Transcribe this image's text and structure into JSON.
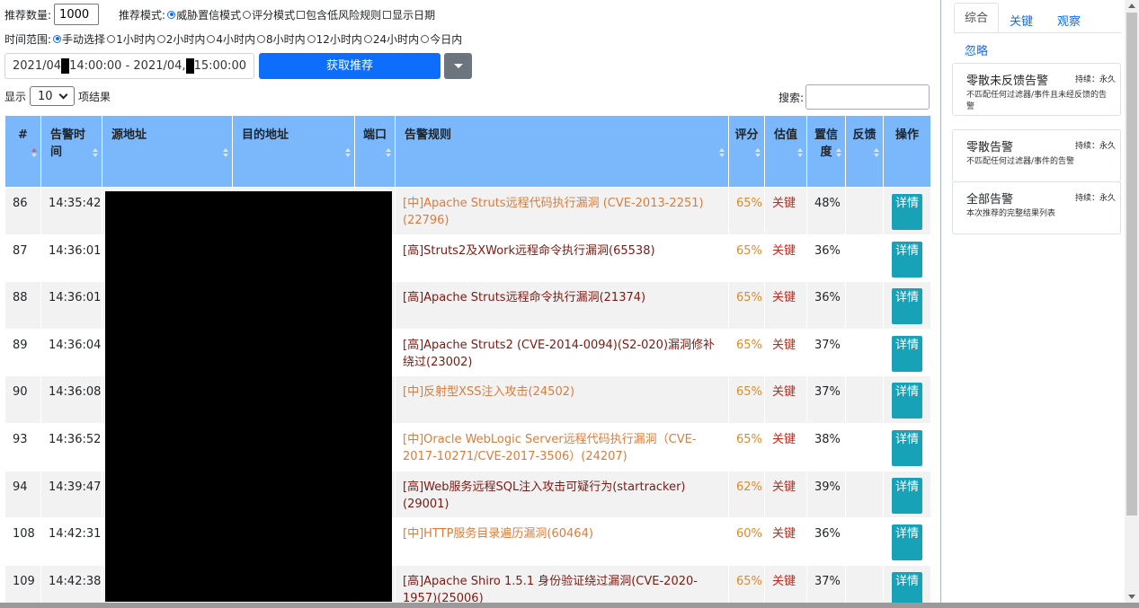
{
  "controls": {
    "count_label": "推荐数量:",
    "count_value": "1000",
    "mode_label": "推荐模式:",
    "mode_options": [
      "威胁置信模式",
      "评分模式"
    ],
    "checkbox_options": [
      "包含低风险规则",
      "显示日期"
    ],
    "time_label": "时间范围:",
    "time_options": [
      "手动选择",
      "1小时内",
      "2小时内",
      "4小时内",
      "8小时内",
      "12小时内",
      "24小时内",
      "今日内"
    ],
    "date_part1": "2021/04",
    "date_part2": " 14:00:00 - 2021/04,",
    "date_part3": "15:00:00",
    "fetch_label": "获取推荐"
  },
  "table_controls": {
    "show_label": "显示",
    "page_size": "10",
    "results_label": "项结果",
    "search_label": "搜索:"
  },
  "table": {
    "headers": [
      "#",
      "告警时间",
      "源地址",
      "目的地址",
      "端口",
      "告警规则",
      "评分",
      "估值",
      "置信度",
      "反馈",
      "操作"
    ],
    "detail_label": "详情",
    "rows": [
      {
        "id": "86",
        "time": "14:35:42",
        "rule": "[中]Apache Struts远程代码执行漏洞 (CVE-2013-2251)(22796)",
        "level": "mid",
        "score": "65%",
        "est": "关键",
        "conf": "48%"
      },
      {
        "id": "87",
        "time": "14:36:01",
        "rule": "[高]Struts2及XWork远程命令执行漏洞(65538)",
        "level": "high",
        "score": "65%",
        "est": "关键",
        "conf": "36%"
      },
      {
        "id": "88",
        "time": "14:36:01",
        "rule": "[高]Apache Struts远程命令执行漏洞(21374)",
        "level": "high",
        "score": "65%",
        "est": "关键",
        "conf": "36%"
      },
      {
        "id": "89",
        "time": "14:36:04",
        "rule": "[高]Apache Struts2 (CVE-2014-0094)(S2-020)漏洞修补绕过(23002)",
        "level": "high",
        "score": "65%",
        "est": "关键",
        "conf": "37%"
      },
      {
        "id": "90",
        "time": "14:36:08",
        "rule": "[中]反射型XSS注入攻击(24502)",
        "level": "mid",
        "score": "65%",
        "est": "关键",
        "conf": "37%"
      },
      {
        "id": "93",
        "time": "14:36:52",
        "rule": "[中]Oracle WebLogic Server远程代码执行漏洞（CVE-2017-10271/CVE-2017-3506）(24207)",
        "level": "mid",
        "score": "65%",
        "est": "关键",
        "conf": "38%"
      },
      {
        "id": "94",
        "time": "14:39:47",
        "rule": "[高]Web服务远程SQL注入攻击可疑行为(startracker)(29001)",
        "level": "high",
        "score": "62%",
        "est": "关键",
        "conf": "39%"
      },
      {
        "id": "108",
        "time": "14:42:31",
        "rule": "[中]HTTP服务目录遍历漏洞(60464)",
        "level": "mid",
        "score": "60%",
        "est": "关键",
        "conf": "36%"
      },
      {
        "id": "109",
        "time": "14:42:38",
        "rule": "[高]Apache Shiro 1.5.1 身份验证绕过漏洞(CVE-2020-1957)(25006)",
        "level": "high",
        "score": "65%",
        "est": "关键",
        "conf": "37%"
      }
    ]
  },
  "sidebar": {
    "tabs": [
      "综合",
      "关键",
      "观察",
      "忽略"
    ],
    "cards": [
      {
        "title": "零散未反馈告警",
        "duration": "持续：永久",
        "desc": "不匹配任何过滤器/事件且未经反馈的告警"
      },
      {
        "title": "零散告警",
        "duration": "持续：永久",
        "desc": "不匹配任何过滤器/事件的告警"
      },
      {
        "title": "全部告警",
        "duration": "持续：永久",
        "desc": "本次推荐的完整结果列表"
      }
    ]
  }
}
